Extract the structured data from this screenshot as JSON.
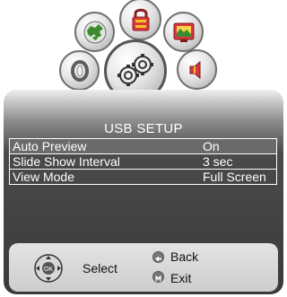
{
  "menu_title": "USB SETUP",
  "settings": [
    {
      "label": "Auto Preview",
      "value": "On"
    },
    {
      "label": "Slide Show Interval",
      "value": "3 sec"
    },
    {
      "label": "View Mode",
      "value": "Full Screen"
    }
  ],
  "footer": {
    "nav_center_label": "OK",
    "select_label": "Select",
    "back_label": "Back",
    "exit_label": "Exit"
  },
  "icons": [
    "earth-globe-icon",
    "lock-icon",
    "display-icon",
    "circle-icon",
    "gears-icon",
    "speaker-icon"
  ],
  "colors": {
    "panel_dark": "#3a3a3a",
    "text_light": "#ffffff",
    "icon_red": "#d8373f",
    "icon_yellow": "#f3c21b",
    "icon_green": "#3e8a2f"
  }
}
